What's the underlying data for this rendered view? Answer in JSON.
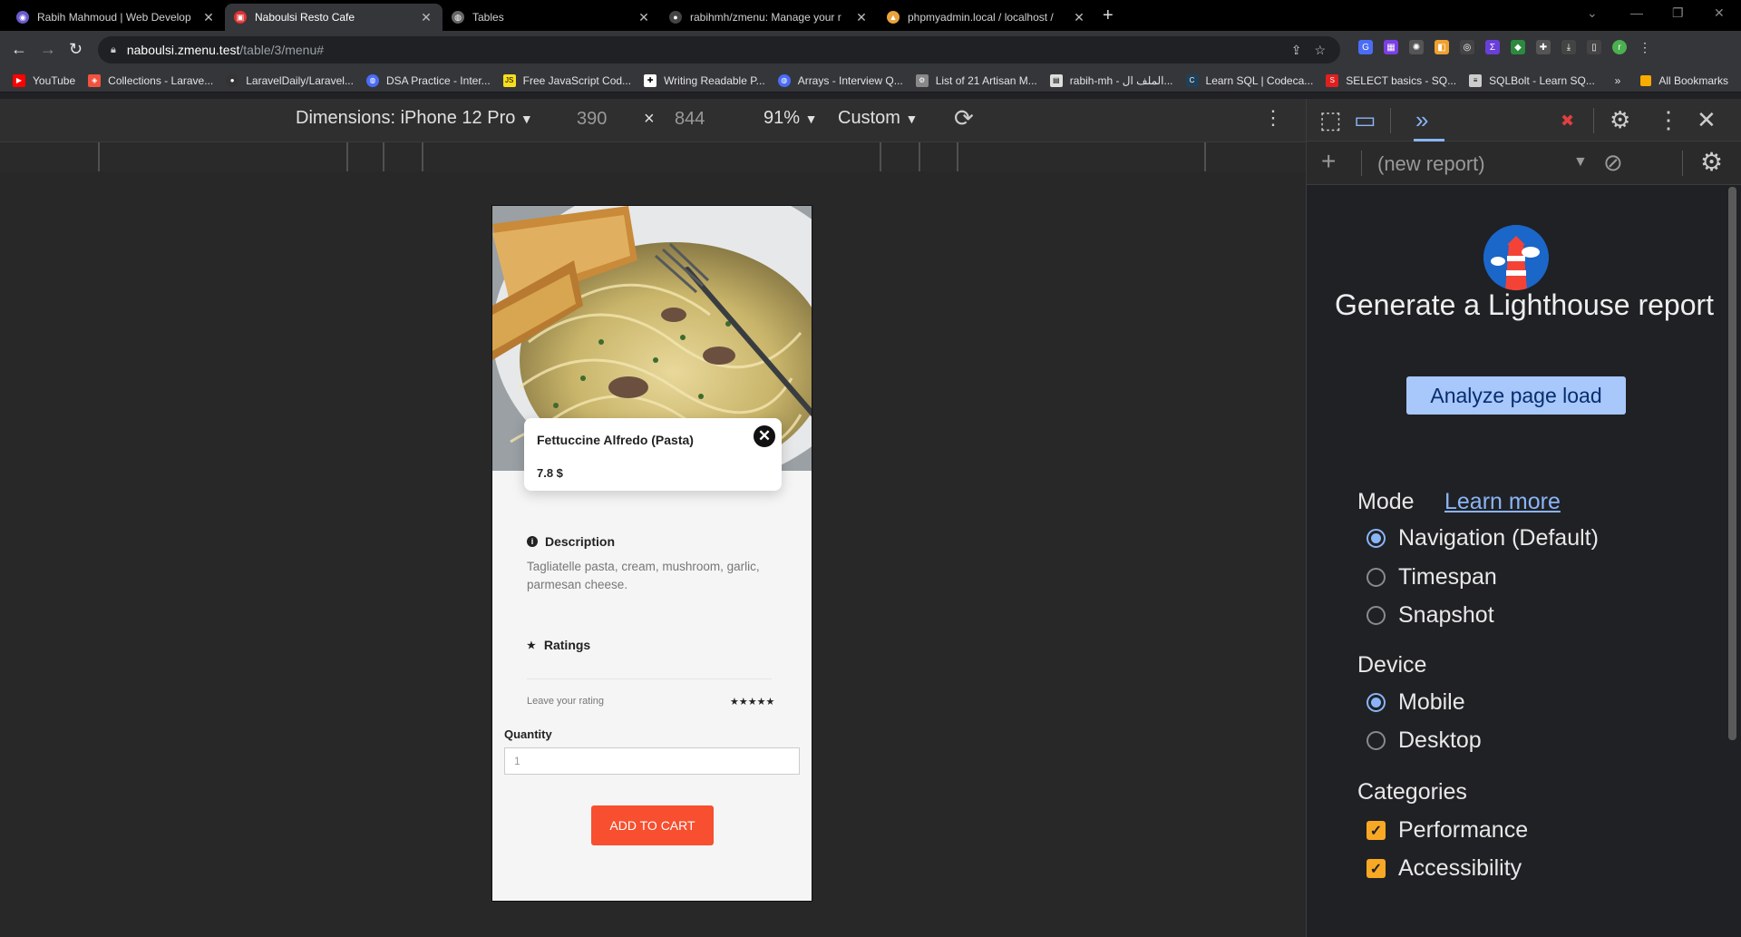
{
  "tabs": [
    {
      "title": "Rabih Mahmoud | Web Develop",
      "icon": "globe-icon",
      "color": "#6a5acd"
    },
    {
      "title": "Naboulsi Resto Cafe",
      "icon": "resto-icon",
      "color": "#d33"
    },
    {
      "title": "Tables",
      "icon": "globe-icon",
      "color": "#aaa"
    },
    {
      "title": "rabihmh/zmenu: Manage your r",
      "icon": "github-icon",
      "color": "#fff"
    },
    {
      "title": "phpmyadmin.local / localhost / ",
      "icon": "phpmyadmin-icon",
      "color": "#e8a33d"
    }
  ],
  "url": {
    "host": "naboulsi.zmenu.test",
    "path": "/table/3/menu#"
  },
  "bookmarks": [
    {
      "label": "YouTube",
      "color": "#ff0000"
    },
    {
      "label": "Collections - Larave...",
      "color": "#f05340"
    },
    {
      "label": "LaravelDaily/Laravel...",
      "color": "#ffffff"
    },
    {
      "label": "DSA Practice - Inter...",
      "color": "#4a6cf7"
    },
    {
      "label": "Free JavaScript Cod...",
      "color": "#f7df1e"
    },
    {
      "label": "Writing Readable P...",
      "color": "#ffffff"
    },
    {
      "label": "Arrays - Interview Q...",
      "color": "#4a6cf7"
    },
    {
      "label": "List of 21 Artisan M...",
      "color": "#888888"
    },
    {
      "label": "rabih-mh - الملف ال...",
      "color": "#dddddd"
    },
    {
      "label": "Learn SQL | Codeca...",
      "color": "#1f4056"
    },
    {
      "label": "SELECT basics - SQ...",
      "color": "#e02020"
    },
    {
      "label": "SQLBolt - Learn SQ...",
      "color": "#cccccc"
    }
  ],
  "bookmarks_more": "»",
  "all_bookmarks": "All Bookmarks",
  "device_toolbar": {
    "dimensions": "Dimensions: iPhone 12 Pro",
    "width": "390",
    "times": "×",
    "height": "844",
    "zoom": "91%",
    "throttle": "Custom"
  },
  "menu_item": {
    "name": "Fettuccine Alfredo (Pasta)",
    "price": "7.8 $",
    "description_title": "Description",
    "description": "Tagliatelle pasta, cream, mushroom, garlic, parmesan cheese.",
    "ratings_title": "Ratings",
    "rating_prompt": "Leave your rating",
    "stars": "★★★★★",
    "quantity_label": "Quantity",
    "quantity_value": "1",
    "add_to_cart": "ADD TO CART"
  },
  "lighthouse": {
    "new_report": "(new report)",
    "title": "Generate a Lighthouse report",
    "analyze": "Analyze page load",
    "mode_label": "Mode",
    "learn_more": "Learn more",
    "modes": [
      "Navigation (Default)",
      "Timespan",
      "Snapshot"
    ],
    "device_label": "Device",
    "devices": [
      "Mobile",
      "Desktop"
    ],
    "categories_label": "Categories",
    "categories": [
      "Performance",
      "Accessibility"
    ]
  },
  "colors": {
    "accent": "#f74f2f",
    "devtools_blue": "#8ab4f8",
    "checkbox": "#f9a825"
  }
}
